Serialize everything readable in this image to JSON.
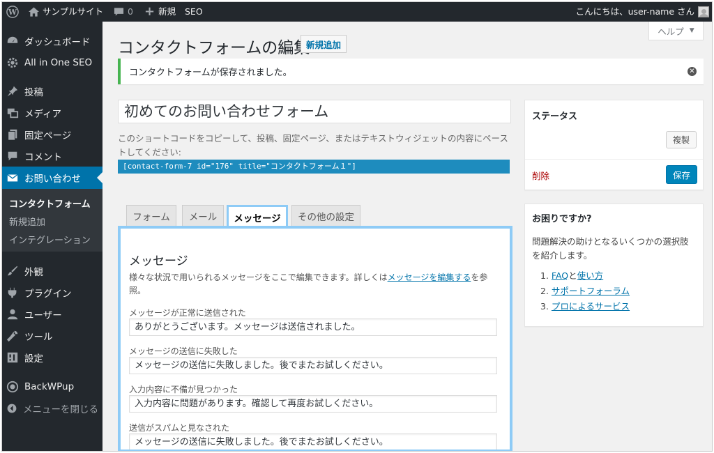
{
  "adminbar": {
    "site_name": "サンプルサイト",
    "comments_count": "0",
    "new_label": "新規",
    "seo_label": "SEO",
    "greeting": "こんにちは、user-name さん"
  },
  "sidebar": {
    "items": [
      {
        "label": "ダッシュボード",
        "icon": "dashboard-icon"
      },
      {
        "label": "All in One SEO",
        "icon": "gear-icon"
      },
      {
        "label": "投稿",
        "icon": "pushpin-icon"
      },
      {
        "label": "メディア",
        "icon": "media-icon"
      },
      {
        "label": "固定ページ",
        "icon": "page-icon"
      },
      {
        "label": "コメント",
        "icon": "comment-icon"
      },
      {
        "label": "お問い合わせ",
        "icon": "envelope-icon"
      },
      {
        "label": "外観",
        "icon": "paintbrush-icon"
      },
      {
        "label": "プラグイン",
        "icon": "plugin-icon"
      },
      {
        "label": "ユーザー",
        "icon": "user-icon"
      },
      {
        "label": "ツール",
        "icon": "wrench-icon"
      },
      {
        "label": "設定",
        "icon": "settings-icon"
      },
      {
        "label": "BackWPup",
        "icon": "backwpup-icon"
      }
    ],
    "submenu": [
      "コンタクトフォーム",
      "新規追加",
      "インテグレーション"
    ],
    "collapse_label": "メニューを閉じる"
  },
  "header": {
    "help_label": "ヘルプ",
    "title": "コンタクトフォームの編集",
    "add_new_label": "新規追加"
  },
  "notice": {
    "text": "コンタクトフォームが保存されました。"
  },
  "form": {
    "title_value": "初めてのお問い合わせフォーム",
    "shortcode_desc": "このショートコードをコピーして、投稿、固定ページ、またはテキストウィジェットの内容にペーストしてください:",
    "shortcode": "[contact-form-7 id=\"176\" title=\"コンタクトフォーム１\"]",
    "tabs": [
      "フォーム",
      "メール",
      "メッセージ",
      "その他の設定"
    ],
    "active_tab": "メッセージ"
  },
  "messages": {
    "heading": "メッセージ",
    "desc_before": "様々な状況で用いられるメッセージをここで編集できます。詳しくは",
    "desc_link": "メッセージを編集する",
    "desc_after": "を参照。",
    "fields": [
      {
        "label": "メッセージが正常に送信された",
        "value": "ありがとうございます。メッセージは送信されました。"
      },
      {
        "label": "メッセージの送信に失敗した",
        "value": "メッセージの送信に失敗しました。後でまたお試しください。"
      },
      {
        "label": "入力内容に不備が見つかった",
        "value": "入力内容に問題があります。確認して再度お試しください。"
      },
      {
        "label": "送信がスパムと見なされた",
        "value": "メッセージの送信に失敗しました。後でまたお試しください。"
      }
    ]
  },
  "status_box": {
    "title": "ステータス",
    "duplicate_label": "複製",
    "delete_label": "削除",
    "save_label": "保存"
  },
  "help_box": {
    "title": "お困りですか?",
    "text": "問題解決の助けとなるいくつかの選択肢を紹介します。",
    "links": [
      {
        "num": "1.",
        "parts": [
          "FAQ",
          "と",
          "使い方"
        ]
      },
      {
        "num": "2.",
        "parts": [
          "サポートフォーラム"
        ]
      },
      {
        "num": "3.",
        "parts": [
          "プロによるサービス"
        ]
      }
    ]
  },
  "colors": {
    "adminbar_bg": "#23282d",
    "accent": "#0073aa",
    "notice_success": "#46b450",
    "tab_highlight": "#8ecbf6",
    "delete": "#aa0000"
  }
}
